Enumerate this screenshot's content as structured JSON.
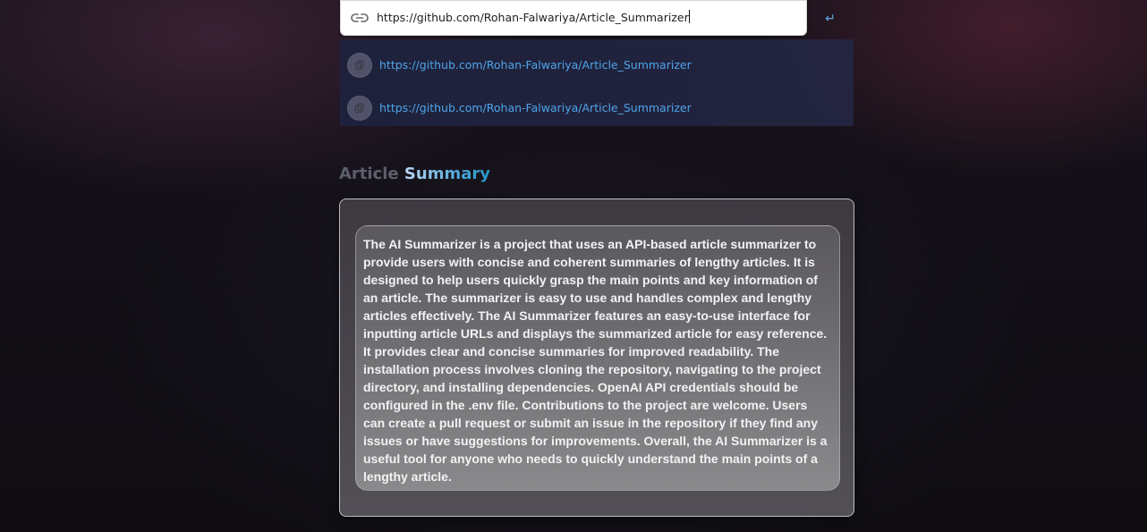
{
  "url_form": {
    "input_value": "https://github.com/Rohan-Falwariya/Article_Summarizer",
    "submit_symbol": "↵",
    "link_icon": "link-icon"
  },
  "history": {
    "items": [
      {
        "url": "https://github.com/Rohan-Falwariya/Article_Summarizer",
        "icon": "copy-icon"
      },
      {
        "url": "https://github.com/Rohan-Falwariya/Article_Summarizer",
        "icon": "copy-icon"
      }
    ]
  },
  "summary": {
    "heading_plain": "Article",
    "heading_accent": "Summary",
    "text": "The AI Summarizer is a project that uses an API-based article summarizer to provide users with concise and coherent summaries of lengthy articles. It is designed to help users quickly grasp the main points and key information of an article. The summarizer is easy to use and handles complex and lengthy articles effectively. The AI Summarizer features an easy-to-use interface for inputting article URLs and displays the summarized article for easy reference. It provides clear and concise summaries for improved readability. The installation process involves cloning the repository, navigating to the project directory, and installing dependencies. OpenAI API credentials should be configured in the .env file. Contributions to the project are welcome. Users can create a pull request or submit an issue in the repository if they find any issues or have suggestions for improvements. Overall, the AI Summarizer is a useful tool for anyone who needs to quickly understand the main points of a lengthy article."
  },
  "colors": {
    "link": "#4ea4ea",
    "accent_gradient_start": "#bcd7f2",
    "accent_gradient_end": "#2596c9",
    "heading_muted": "#5d5f6c"
  }
}
